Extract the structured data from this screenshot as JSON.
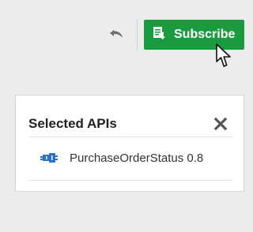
{
  "toolbar": {
    "subscribe_label": "Subscribe",
    "subscribe_color": "#1a9b3f"
  },
  "panel": {
    "title": "Selected APIs",
    "items": [
      {
        "label": "PurchaseOrderStatus 0.8",
        "icon": "api-plugin-icon",
        "icon_color": "#2c73c8"
      }
    ]
  },
  "icons": {
    "undo": "undo-icon",
    "subscribe": "subscribe-document-icon",
    "close": "close-icon",
    "cursor": "mouse-cursor-icon"
  }
}
